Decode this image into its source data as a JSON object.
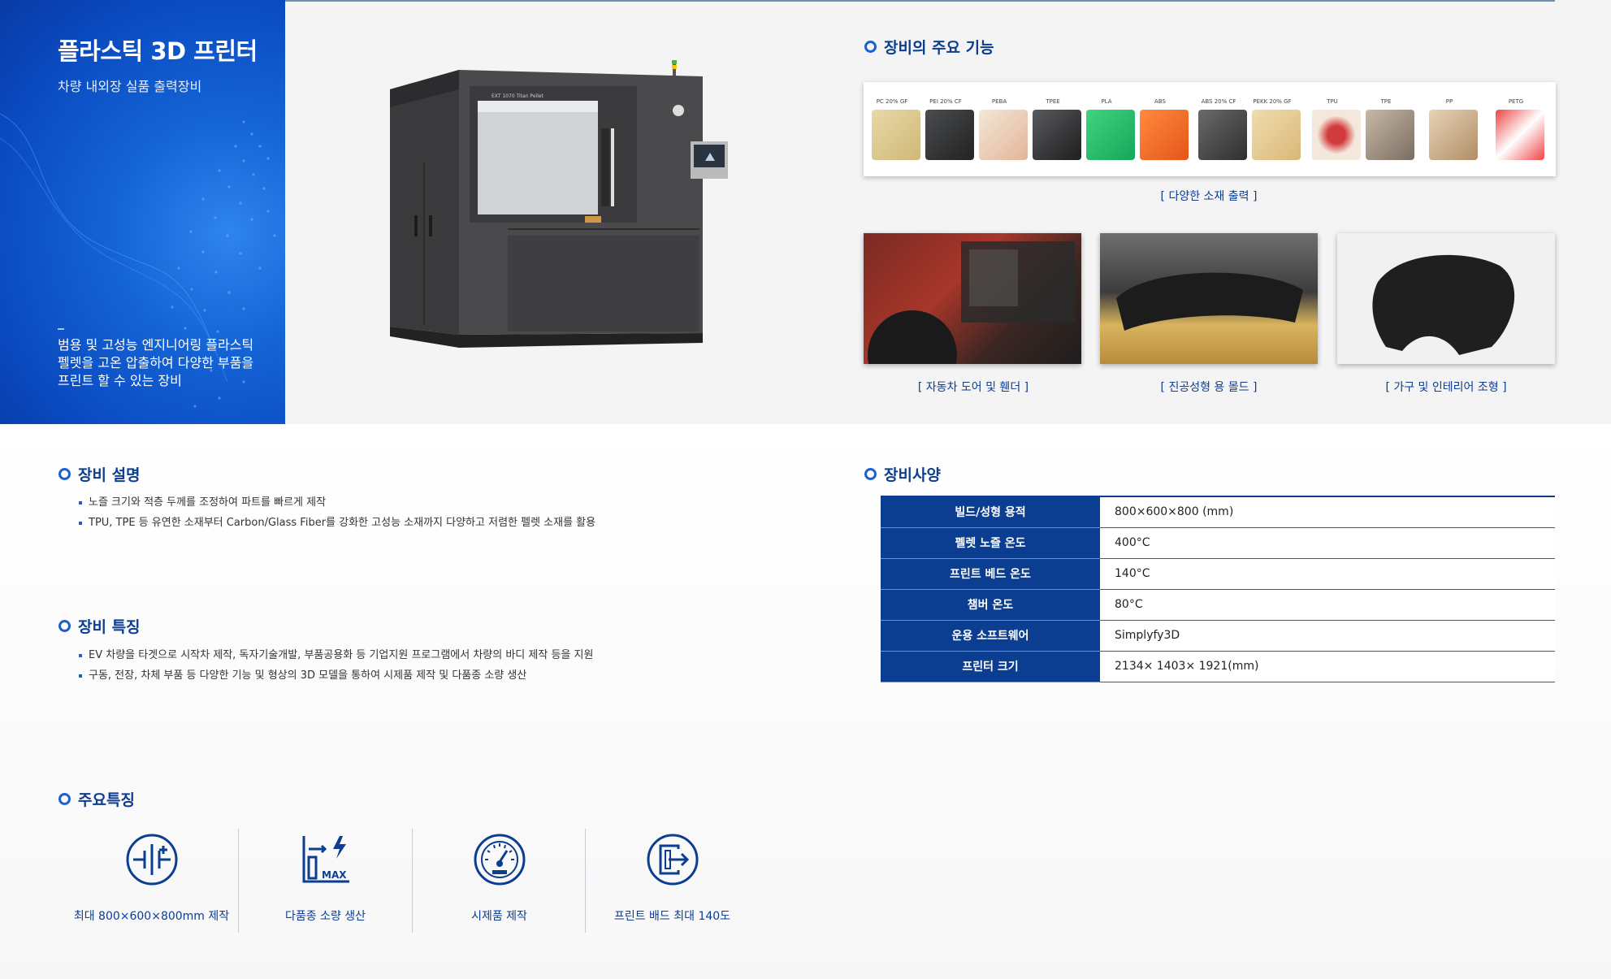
{
  "hero": {
    "title": "플라스틱 3D 프린터",
    "subtitle": "차량 내외장 실품 출력장비",
    "description": "범용 및 고성능 엔지니어링 플라스틱 펠렛을 고온 압출하여 다양한 부품을 프린트 할 수 있는 장비"
  },
  "printer_label": "EXT 1070 Titan Pellet",
  "main_functions": {
    "title": "장비의 주요 기능",
    "materials": [
      "PC 20% GF",
      "PEI 20% CF",
      "PEBA",
      "TPEE",
      "PLA",
      "ABS",
      "ABS 20% CF",
      "PEKK 20% GF",
      "TPU",
      "TPE",
      "PP",
      "PETG"
    ],
    "materials_caption": "[ 다양한 소재 출력 ]",
    "photos": [
      {
        "caption": "[ 자동차 도어 및 휀더 ]"
      },
      {
        "caption": "[ 진공성형 용 몰드 ]"
      },
      {
        "caption": "[ 가구 및 인테리어 조형 ]"
      }
    ]
  },
  "description_section": {
    "title": "장비 설명",
    "items": [
      "노즐 크기와 적층 두께를 조정하여 파트를 빠르게 제작",
      "TPU, TPE 등 유연한 소재부터 Carbon/Glass Fiber를 강화한 고성능 소재까지 다양하고 저렴한 펠렛 소재를 활용"
    ]
  },
  "features_section": {
    "title": "장비 특징",
    "items": [
      "EV 차량을 타겟으로 시작차 제작, 독자기술개발, 부품공용화 등 기업지원 프로그램에서 차량의 바디 제작 등을 지원",
      "구동, 전장, 차체 부품 등 다양한 기능 및 형상의 3D 모델을 통하여 시제품 제작 및 다품종 소량  생산"
    ]
  },
  "spec_section": {
    "title": "장비사양",
    "rows": [
      {
        "key": "빌드/성형 용적",
        "value": "800×600×800 (mm)"
      },
      {
        "key": "펠렛 노즐 온도",
        "value": "400°C"
      },
      {
        "key": "프린트 베드 온도",
        "value": "140°C"
      },
      {
        "key": "챔버 온도",
        "value": "80°C"
      },
      {
        "key": "운용 소프트웨어",
        "value": "Simplyfy3D"
      },
      {
        "key": "프린터 크기",
        "value": "2134× 1403× 1921(mm)"
      }
    ]
  },
  "key_features": {
    "title": "주요특징",
    "items": [
      {
        "icon": "size-plus-icon",
        "label": "최대 800×600×800mm 제작"
      },
      {
        "icon": "max-production-icon",
        "label": "다품종 소량 생산"
      },
      {
        "icon": "gauge-icon",
        "label": "시제품 제작"
      },
      {
        "icon": "export-arrow-icon",
        "label": "프린트 배드 최대 140도"
      }
    ]
  },
  "colors": {
    "primary": "#0b3d91",
    "accent": "#1f5fc8",
    "hero_blue": "#1464d6"
  }
}
